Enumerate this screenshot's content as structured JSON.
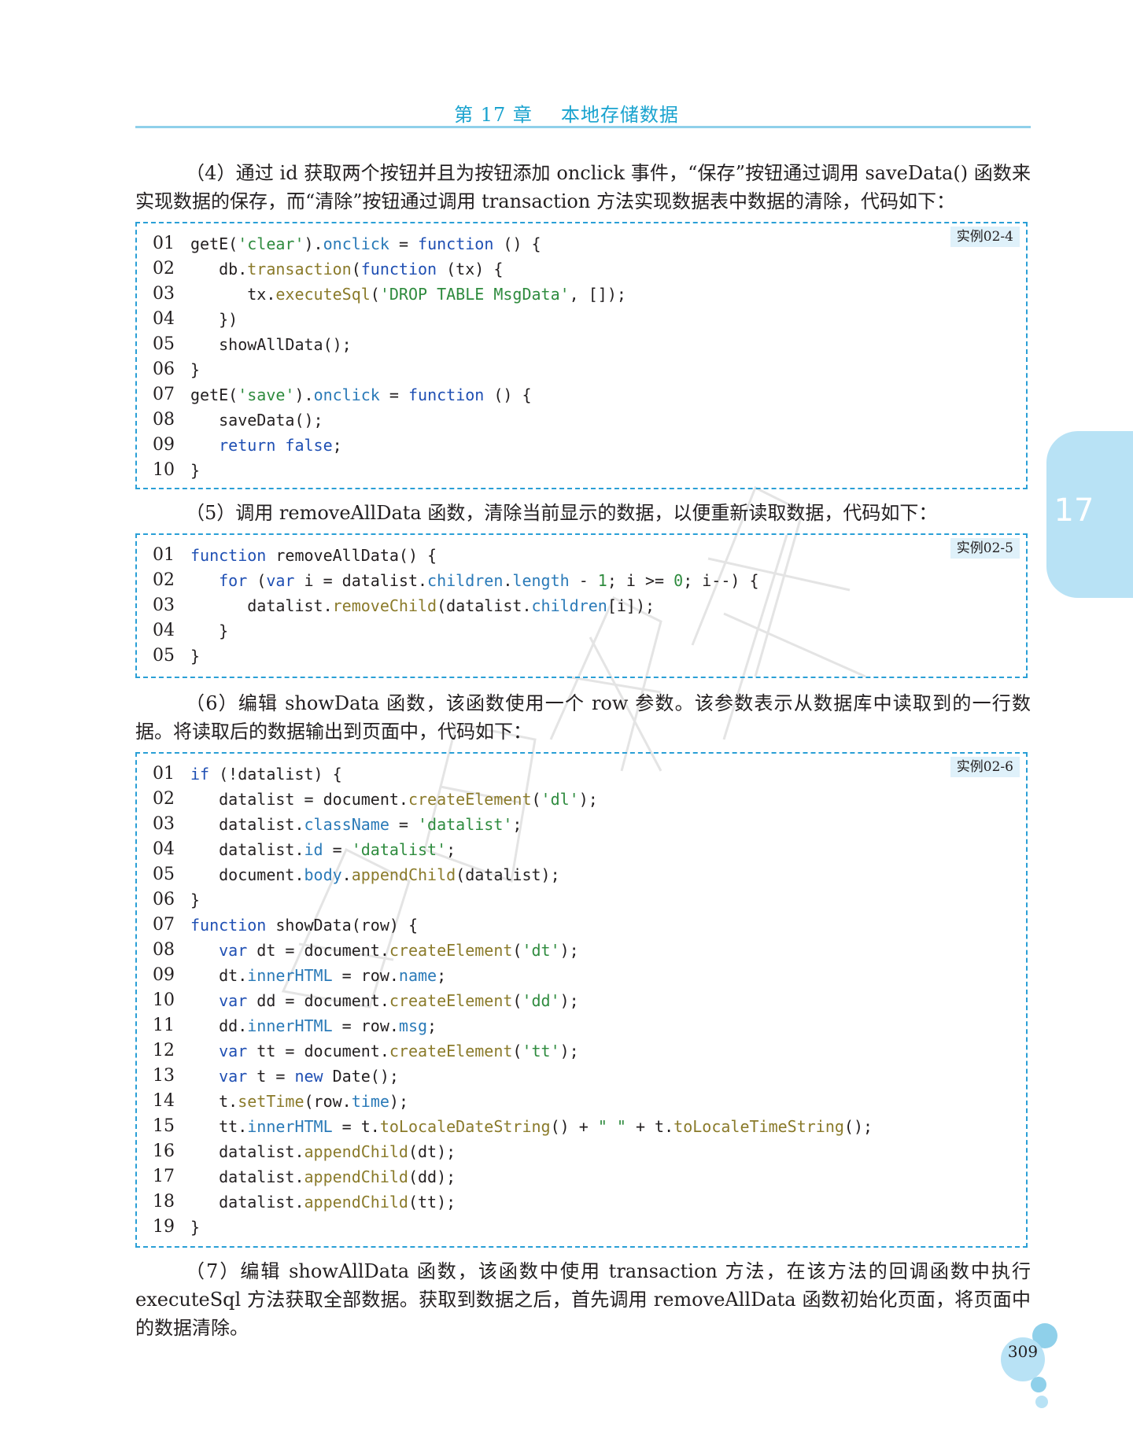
{
  "header": {
    "chapter": "第 17 章",
    "title": "本地存储数据"
  },
  "paragraphs": {
    "p4": "（4）通过 id 获取两个按钮并且为按钮添加 onclick 事件，“保存”按钮通过调用 saveData() 函数来实现数据的保存，而“清除”按钮通过调用 transaction 方法实现数据表中数据的清除，代码如下：",
    "p5": "（5）调用 removeAllData 函数，清除当前显示的数据，以便重新读取数据，代码如下：",
    "p6": "（6）编辑 showData 函数，该函数使用一个 row 参数。该参数表示从数据库中读取到的一行数据。将读取后的数据输出到页面中，代码如下：",
    "p7": "（7）编辑 showAllData 函数，该函数中使用 transaction 方法，在该方法的回调函数中执行 executeSql 方法获取全部数据。获取到数据之后，首先调用 removeAllData 函数初始化页面，将页面中的数据清除。"
  },
  "code_blocks": [
    {
      "tag": "实例02-4",
      "lines": [
        {
          "num": "01",
          "code": "getE('clear').onclick = function () {"
        },
        {
          "num": "02",
          "code": "   db.transaction(function (tx) {"
        },
        {
          "num": "03",
          "code": "      tx.executeSql('DROP TABLE MsgData', []);"
        },
        {
          "num": "04",
          "code": "   })"
        },
        {
          "num": "05",
          "code": "   showAllData();"
        },
        {
          "num": "06",
          "code": "}"
        },
        {
          "num": "07",
          "code": "getE('save').onclick = function () {"
        },
        {
          "num": "08",
          "code": "   saveData();"
        },
        {
          "num": "09",
          "code": "   return false;"
        },
        {
          "num": "10",
          "code": "}"
        }
      ]
    },
    {
      "tag": "实例02-5",
      "lines": [
        {
          "num": "01",
          "code": "function removeAllData() {"
        },
        {
          "num": "02",
          "code": "   for (var i = datalist.children.length - 1; i >= 0; i--) {"
        },
        {
          "num": "03",
          "code": "      datalist.removeChild(datalist.children[i]);"
        },
        {
          "num": "04",
          "code": "   }"
        },
        {
          "num": "05",
          "code": "}"
        }
      ]
    },
    {
      "tag": "实例02-6",
      "lines": [
        {
          "num": "01",
          "code": "if (!datalist) {"
        },
        {
          "num": "02",
          "code": "   datalist = document.createElement('dl');"
        },
        {
          "num": "03",
          "code": "   datalist.className = 'datalist';"
        },
        {
          "num": "04",
          "code": "   datalist.id = 'datalist';"
        },
        {
          "num": "05",
          "code": "   document.body.appendChild(datalist);"
        },
        {
          "num": "06",
          "code": "}"
        },
        {
          "num": "07",
          "code": "function showData(row) {"
        },
        {
          "num": "08",
          "code": "   var dt = document.createElement('dt');"
        },
        {
          "num": "09",
          "code": "   dt.innerHTML = row.name;"
        },
        {
          "num": "10",
          "code": "   var dd = document.createElement('dd');"
        },
        {
          "num": "11",
          "code": "   dd.innerHTML = row.msg;"
        },
        {
          "num": "12",
          "code": "   var tt = document.createElement('tt');"
        },
        {
          "num": "13",
          "code": "   var t = new Date();"
        },
        {
          "num": "14",
          "code": "   t.setTime(row.time);"
        },
        {
          "num": "15",
          "code": "   tt.innerHTML = t.toLocaleDateString() + \" \" + t.toLocaleTimeString();"
        },
        {
          "num": "16",
          "code": "   datalist.appendChild(dt);"
        },
        {
          "num": "17",
          "code": "   datalist.appendChild(dd);"
        },
        {
          "num": "18",
          "code": "   datalist.appendChild(tt);"
        },
        {
          "num": "19",
          "code": "}"
        }
      ]
    }
  ],
  "side_tab": {
    "chapter_number": "17"
  },
  "footer": {
    "page_number": "309"
  },
  "watermark_text": "明日科技",
  "colors": {
    "accent": "#1aa3cf",
    "code_border": "#2a9fd6",
    "side_tab": "#b8e2f5",
    "keyword": "#1f4fb3",
    "string": "#2e8b3e"
  }
}
